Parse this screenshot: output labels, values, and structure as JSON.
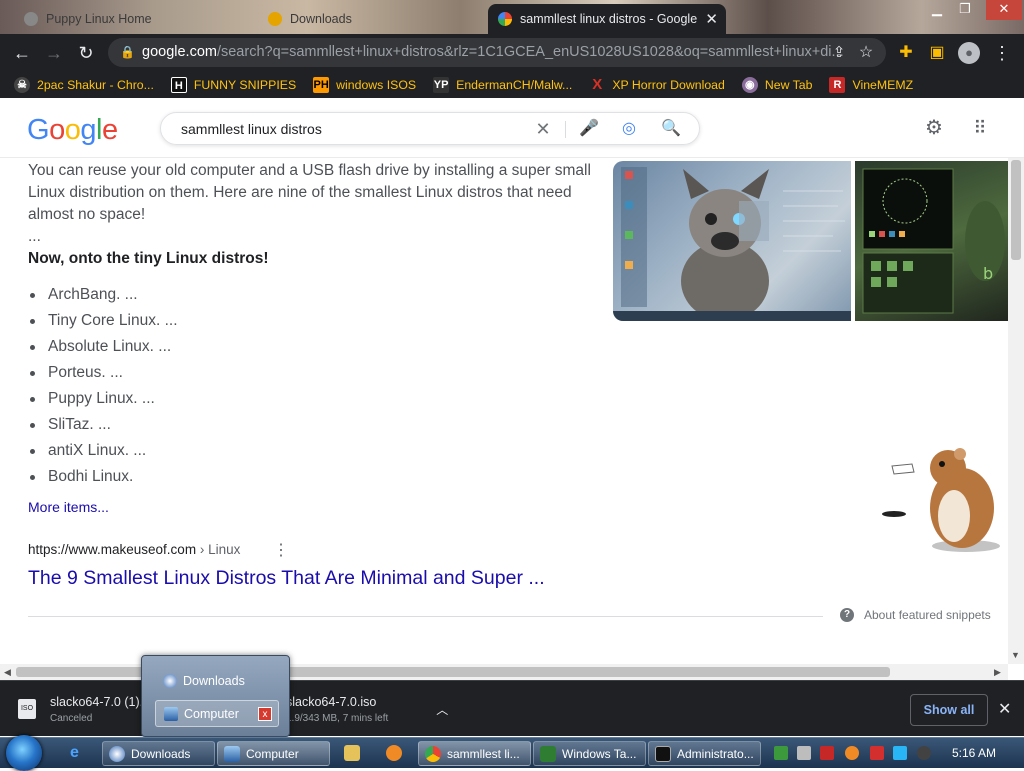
{
  "browser": {
    "tabs": [
      {
        "title": "Puppy Linux Home",
        "active": false
      },
      {
        "title": "Downloads",
        "active": false
      },
      {
        "title": "sammllest linux distros - Google",
        "active": true
      }
    ],
    "url_host": "google.com",
    "url_rest": "/search?q=sammllest+linux+distros&rlz=1C1GCEA_enUS1028US1028&oq=sammllest+linux+di...",
    "bookmarks": [
      {
        "label": "2pac Shakur - Chro...",
        "icon": "skull-icon",
        "color": "#444444"
      },
      {
        "label": "FUNNY SNIPPIES",
        "icon": "h-icon",
        "color": "#111111"
      },
      {
        "label": "windows ISOS",
        "icon": "ph-icon",
        "color": "#ff9900"
      },
      {
        "label": "EndermanCH/Malw...",
        "icon": "yp-icon",
        "color": "#333333"
      },
      {
        "label": "XP Horror Download",
        "icon": "x-icon",
        "color": "#d93025"
      },
      {
        "label": "New Tab",
        "icon": "globe-icon",
        "color": "#8a6d9b"
      },
      {
        "label": "VineMEMZ",
        "icon": "r-icon",
        "color": "#c62828"
      }
    ],
    "accent_color": "#ffc20e"
  },
  "google": {
    "query": "sammllest linux distros",
    "snippet": {
      "text": "You can reuse your old computer and a USB flash drive by installing a super small Linux distribution on them. Here are nine of the smallest Linux distros that need almost no space!",
      "ellipsis": "...",
      "bold_line": "Now, onto the tiny Linux distros!",
      "items": [
        "ArchBang. ...",
        "Tiny Core Linux. ...",
        "Absolute Linux. ...",
        "Porteus. ...",
        "Puppy Linux. ...",
        "SliTaz. ...",
        "antiX Linux. ...",
        "Bodhi Linux."
      ],
      "more_items": "More items...",
      "source_url": "https://www.makeuseof.com",
      "source_crumb": " › Linux",
      "result_title": "The 9 Smallest Linux Distros That Are Minimal and Super ...",
      "about": "About featured snippets"
    }
  },
  "downloads": {
    "items": [
      {
        "name": "slacko64-7.0 (1).iso",
        "status": "Canceled"
      },
      {
        "name": "slacko64-7.0.iso",
        "status": "1.9/343 MB, 7 mins left"
      }
    ],
    "show_all": "Show all"
  },
  "taskbar": {
    "popup": [
      {
        "label": "Downloads"
      },
      {
        "label": "Computer"
      }
    ],
    "buttons": [
      {
        "label": "Downloads",
        "color": "#3b6fb8"
      },
      {
        "label": "Computer",
        "color": "#2b5fa3"
      },
      {
        "label": "sammllest li...",
        "color": "#4caf50"
      },
      {
        "label": "Windows Ta...",
        "color": "#2e7d32"
      },
      {
        "label": "Administrato...",
        "color": "#111111"
      }
    ],
    "clock": "5:16 AM"
  }
}
